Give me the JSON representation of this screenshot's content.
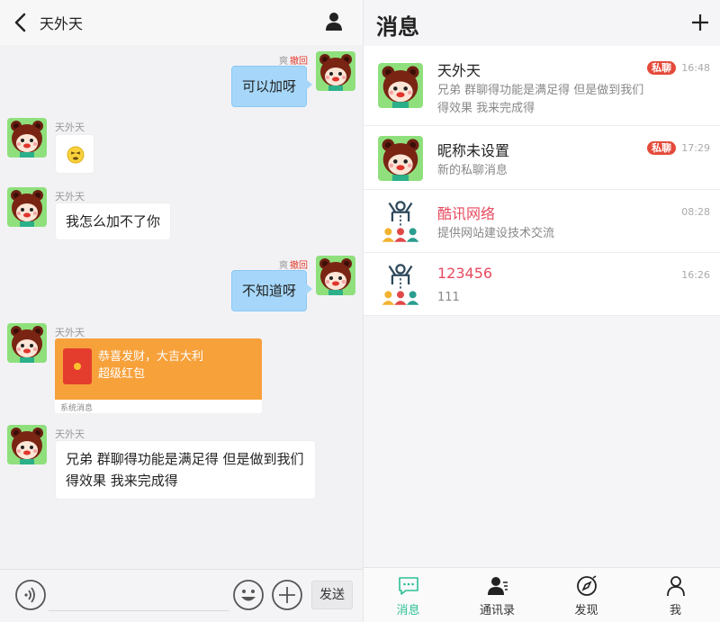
{
  "chat": {
    "title": "天外天",
    "messages": [
      {
        "dir": "out",
        "meta_name": "爽",
        "meta_action": "撤回",
        "text": "可以加呀"
      },
      {
        "dir": "in",
        "sender": "天外天",
        "emoji": "scrunched-face-emoji"
      },
      {
        "dir": "in",
        "sender": "天外天",
        "text": "我怎么加不了你"
      },
      {
        "dir": "out",
        "meta_name": "爽",
        "meta_action": "撤回",
        "text": "不知道呀"
      },
      {
        "dir": "in",
        "sender": "天外天",
        "redpacket": {
          "title": "恭喜发财，大吉大利",
          "subtitle": "超级红包",
          "footer": "系统消息"
        }
      },
      {
        "dir": "in",
        "sender": "天外天",
        "text_line1": "兄弟 群聊得功能是满足得 但是做到我们",
        "text_line2": "得效果 我来完成得"
      }
    ],
    "input": {
      "value": "",
      "send_label": "发送"
    }
  },
  "messages_page": {
    "title": "消息",
    "conversations": [
      {
        "name": "天外天",
        "badge": "私聊",
        "time": "16:48",
        "preview_line1": "兄弟 群聊得功能是满足得 但是做到我们",
        "preview_line2": "得效果 我来完成得",
        "avatar": "bear"
      },
      {
        "name": "昵称未设置",
        "badge": "私聊",
        "time": "17:29",
        "preview_line1": "新的私聊消息",
        "avatar": "bear"
      },
      {
        "name": "酷讯网络",
        "time": "08:28",
        "preview_line1": "提供网站建设技术交流",
        "avatar": "group"
      },
      {
        "name": "123456",
        "time": "16:26",
        "preview_line1": "111",
        "avatar": "group"
      }
    ],
    "tabs": [
      {
        "label": "消息",
        "icon": "chat-bubble-icon",
        "active": true
      },
      {
        "label": "通讯录",
        "icon": "contacts-icon",
        "active": false
      },
      {
        "label": "发现",
        "icon": "compass-icon",
        "active": false
      },
      {
        "label": "我",
        "icon": "person-icon",
        "active": false
      }
    ]
  },
  "colors": {
    "accent": "#2dbf94",
    "bubble_out": "#a6d7fa",
    "badge": "#e44a3a",
    "redpacket": "#f7a13b"
  }
}
